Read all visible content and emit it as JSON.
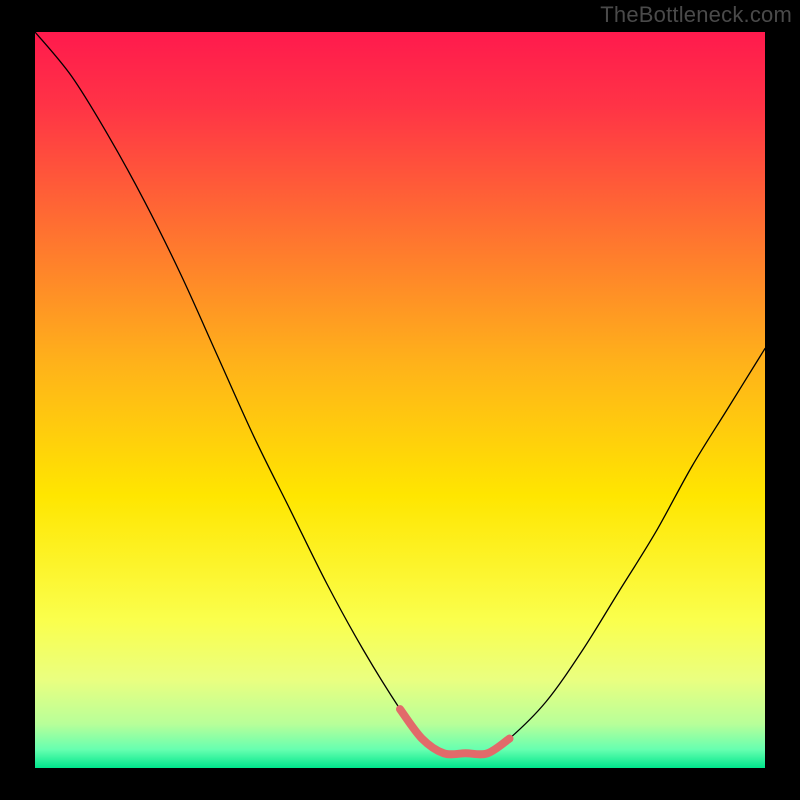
{
  "watermark": "TheBottleneck.com",
  "chart_data": {
    "type": "line",
    "title": "",
    "xlabel": "",
    "ylabel": "",
    "xlim": [
      0,
      100
    ],
    "ylim": [
      0,
      100
    ],
    "grid": false,
    "legend": false,
    "background_gradient": {
      "type": "vertical",
      "stops": [
        {
          "pos": 0.0,
          "color": "#ff1a4d"
        },
        {
          "pos": 0.1,
          "color": "#ff3346"
        },
        {
          "pos": 0.25,
          "color": "#ff6a33"
        },
        {
          "pos": 0.45,
          "color": "#ffb21a"
        },
        {
          "pos": 0.63,
          "color": "#ffe600"
        },
        {
          "pos": 0.8,
          "color": "#faff4d"
        },
        {
          "pos": 0.88,
          "color": "#eaff80"
        },
        {
          "pos": 0.94,
          "color": "#b8ff99"
        },
        {
          "pos": 0.975,
          "color": "#66ffb0"
        },
        {
          "pos": 1.0,
          "color": "#00e68c"
        }
      ]
    },
    "series": [
      {
        "name": "bottleneck-curve",
        "color": "#000000",
        "stroke_width": 1.3,
        "x": [
          0,
          5,
          10,
          15,
          20,
          25,
          30,
          35,
          40,
          45,
          50,
          53,
          56,
          59,
          62,
          65,
          70,
          75,
          80,
          85,
          90,
          95,
          100
        ],
        "y": [
          100,
          94,
          86,
          77,
          67,
          56,
          45,
          35,
          25,
          16,
          8,
          4,
          2,
          2,
          2,
          4,
          9,
          16,
          24,
          32,
          41,
          49,
          57
        ]
      }
    ],
    "highlight_segment": {
      "name": "optimal-zone",
      "color": "#e26a6a",
      "stroke_width": 8,
      "x": [
        50,
        53,
        56,
        59,
        62,
        65
      ],
      "y": [
        8,
        4,
        2,
        2,
        2,
        4
      ]
    },
    "annotations": []
  }
}
